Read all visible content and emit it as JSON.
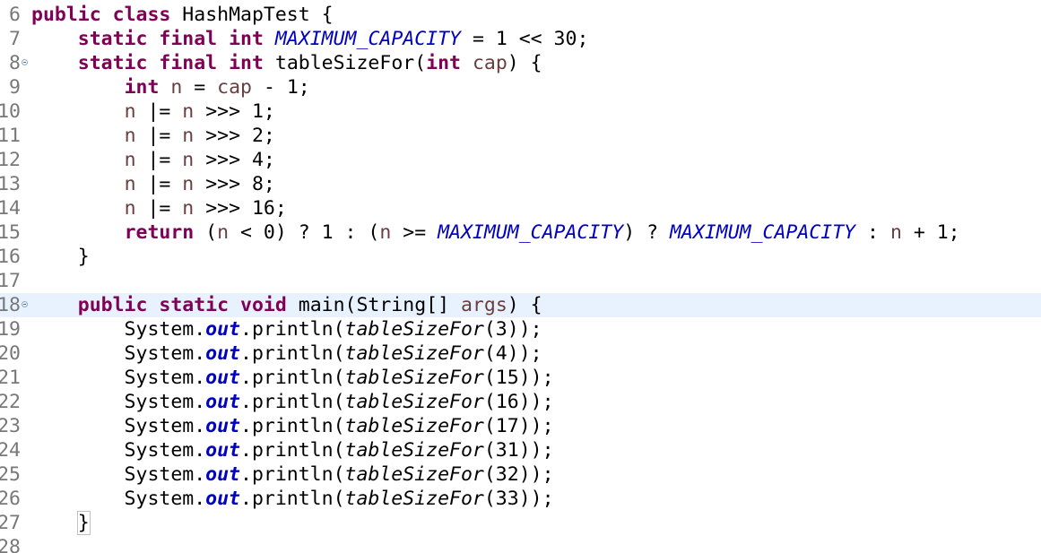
{
  "colors": {
    "keyword": "#7f0055",
    "static_field": "#0000c0",
    "parameter": "#6a3e3e",
    "line_number": "#787878",
    "current_line_bg": "#e8f2fe"
  },
  "lines": [
    {
      "num": "6",
      "tokens": [
        {
          "t": "public",
          "c": "kw"
        },
        {
          "t": " "
        },
        {
          "t": "class",
          "c": "kw"
        },
        {
          "t": " HashMapTest {"
        }
      ]
    },
    {
      "num": "7",
      "tokens": [
        {
          "t": "    "
        },
        {
          "t": "static",
          "c": "kw"
        },
        {
          "t": " "
        },
        {
          "t": "final",
          "c": "kw"
        },
        {
          "t": " "
        },
        {
          "t": "int",
          "c": "kw"
        },
        {
          "t": " "
        },
        {
          "t": "MAXIMUM_CAPACITY",
          "c": "sf"
        },
        {
          "t": " = 1 << 30;"
        }
      ]
    },
    {
      "num": "8",
      "fold": true,
      "tokens": [
        {
          "t": "    "
        },
        {
          "t": "static",
          "c": "kw"
        },
        {
          "t": " "
        },
        {
          "t": "final",
          "c": "kw"
        },
        {
          "t": " "
        },
        {
          "t": "int",
          "c": "kw"
        },
        {
          "t": " tableSizeFor("
        },
        {
          "t": "int",
          "c": "kw"
        },
        {
          "t": " "
        },
        {
          "t": "cap",
          "c": "pv"
        },
        {
          "t": ") {"
        }
      ]
    },
    {
      "num": "9",
      "tokens": [
        {
          "t": "        "
        },
        {
          "t": "int",
          "c": "kw"
        },
        {
          "t": " "
        },
        {
          "t": "n",
          "c": "pv"
        },
        {
          "t": " = "
        },
        {
          "t": "cap",
          "c": "pv"
        },
        {
          "t": " - 1;"
        }
      ]
    },
    {
      "num": "10",
      "tokens": [
        {
          "t": "        "
        },
        {
          "t": "n",
          "c": "pv"
        },
        {
          "t": " |= "
        },
        {
          "t": "n",
          "c": "pv"
        },
        {
          "t": " >>> 1;"
        }
      ]
    },
    {
      "num": "11",
      "tokens": [
        {
          "t": "        "
        },
        {
          "t": "n",
          "c": "pv"
        },
        {
          "t": " |= "
        },
        {
          "t": "n",
          "c": "pv"
        },
        {
          "t": " >>> 2;"
        }
      ]
    },
    {
      "num": "12",
      "tokens": [
        {
          "t": "        "
        },
        {
          "t": "n",
          "c": "pv"
        },
        {
          "t": " |= "
        },
        {
          "t": "n",
          "c": "pv"
        },
        {
          "t": " >>> 4;"
        }
      ]
    },
    {
      "num": "13",
      "tokens": [
        {
          "t": "        "
        },
        {
          "t": "n",
          "c": "pv"
        },
        {
          "t": " |= "
        },
        {
          "t": "n",
          "c": "pv"
        },
        {
          "t": " >>> 8;"
        }
      ]
    },
    {
      "num": "14",
      "tokens": [
        {
          "t": "        "
        },
        {
          "t": "n",
          "c": "pv"
        },
        {
          "t": " |= "
        },
        {
          "t": "n",
          "c": "pv"
        },
        {
          "t": " >>> 16;"
        }
      ]
    },
    {
      "num": "15",
      "tokens": [
        {
          "t": "        "
        },
        {
          "t": "return",
          "c": "kw"
        },
        {
          "t": " ("
        },
        {
          "t": "n",
          "c": "pv"
        },
        {
          "t": " < 0) ? 1 : ("
        },
        {
          "t": "n",
          "c": "pv"
        },
        {
          "t": " >= "
        },
        {
          "t": "MAXIMUM_CAPACITY",
          "c": "sf"
        },
        {
          "t": ") ? "
        },
        {
          "t": "MAXIMUM_CAPACITY",
          "c": "sf"
        },
        {
          "t": " : "
        },
        {
          "t": "n",
          "c": "pv"
        },
        {
          "t": " + 1;"
        }
      ]
    },
    {
      "num": "16",
      "tokens": [
        {
          "t": "    }"
        }
      ]
    },
    {
      "num": "17",
      "tokens": []
    },
    {
      "num": "18",
      "fold": true,
      "current": true,
      "tokens": [
        {
          "t": "    "
        },
        {
          "t": "public",
          "c": "kw"
        },
        {
          "t": " "
        },
        {
          "t": "static",
          "c": "kw"
        },
        {
          "t": " "
        },
        {
          "t": "void",
          "c": "kw"
        },
        {
          "t": " main(String[] "
        },
        {
          "t": "args",
          "c": "pv"
        },
        {
          "t": ") {"
        }
      ]
    },
    {
      "num": "19",
      "tokens": [
        {
          "t": "        System."
        },
        {
          "t": "out",
          "c": "fi"
        },
        {
          "t": ".println("
        },
        {
          "t": "tableSizeFor",
          "c": "sm"
        },
        {
          "t": "(3));"
        }
      ]
    },
    {
      "num": "20",
      "tokens": [
        {
          "t": "        System."
        },
        {
          "t": "out",
          "c": "fi"
        },
        {
          "t": ".println("
        },
        {
          "t": "tableSizeFor",
          "c": "sm"
        },
        {
          "t": "(4));"
        }
      ]
    },
    {
      "num": "21",
      "tokens": [
        {
          "t": "        System."
        },
        {
          "t": "out",
          "c": "fi"
        },
        {
          "t": ".println("
        },
        {
          "t": "tableSizeFor",
          "c": "sm"
        },
        {
          "t": "(15));"
        }
      ]
    },
    {
      "num": "22",
      "tokens": [
        {
          "t": "        System."
        },
        {
          "t": "out",
          "c": "fi"
        },
        {
          "t": ".println("
        },
        {
          "t": "tableSizeFor",
          "c": "sm"
        },
        {
          "t": "(16));"
        }
      ]
    },
    {
      "num": "23",
      "tokens": [
        {
          "t": "        System."
        },
        {
          "t": "out",
          "c": "fi"
        },
        {
          "t": ".println("
        },
        {
          "t": "tableSizeFor",
          "c": "sm"
        },
        {
          "t": "(17));"
        }
      ]
    },
    {
      "num": "24",
      "tokens": [
        {
          "t": "        System."
        },
        {
          "t": "out",
          "c": "fi"
        },
        {
          "t": ".println("
        },
        {
          "t": "tableSizeFor",
          "c": "sm"
        },
        {
          "t": "(31));"
        }
      ]
    },
    {
      "num": "25",
      "tokens": [
        {
          "t": "        System."
        },
        {
          "t": "out",
          "c": "fi"
        },
        {
          "t": ".println("
        },
        {
          "t": "tableSizeFor",
          "c": "sm"
        },
        {
          "t": "(32));"
        }
      ]
    },
    {
      "num": "26",
      "tokens": [
        {
          "t": "        System."
        },
        {
          "t": "out",
          "c": "fi"
        },
        {
          "t": ".println("
        },
        {
          "t": "tableSizeFor",
          "c": "sm"
        },
        {
          "t": "(33));"
        }
      ]
    },
    {
      "num": "27",
      "tokens": [
        {
          "t": "    "
        },
        {
          "t": "}",
          "c": "brk"
        }
      ]
    },
    {
      "num": "28",
      "tokens": []
    }
  ]
}
